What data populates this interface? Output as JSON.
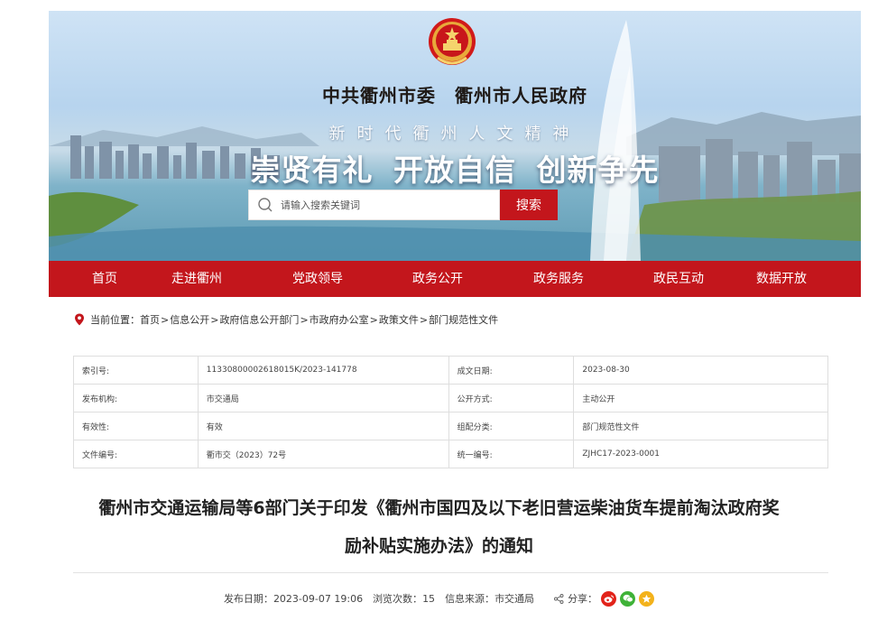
{
  "header": {
    "gov_title": "中共衢州市委　衢州市人民政府",
    "slogan_top": "新时代衢州人文精神",
    "slogan_main": "崇贤有礼 开放自信 创新争先",
    "search": {
      "placeholder": "请输入搜索关键词",
      "button_label": "搜索"
    },
    "colors": {
      "brand_red": "#c3161c"
    }
  },
  "nav": {
    "items": [
      {
        "label": "首页"
      },
      {
        "label": "走进衢州"
      },
      {
        "label": "党政领导"
      },
      {
        "label": "政务公开"
      },
      {
        "label": "政务服务"
      },
      {
        "label": "政民互动"
      },
      {
        "label": "数据开放"
      }
    ]
  },
  "breadcrumb": {
    "prefix": "当前位置：",
    "items": [
      "首页",
      "信息公开",
      "政府信息公开部门",
      "市政府办公室",
      "政策文件",
      "部门规范性文件"
    ],
    "separator": ">"
  },
  "meta_table": {
    "rows": [
      {
        "k1": "索引号:",
        "v1": "11330800002618015K/2023-141778",
        "k2": "成文日期:",
        "v2": "2023-08-30"
      },
      {
        "k1": "发布机构:",
        "v1": "市交通局",
        "k2": "公开方式:",
        "v2": "主动公开"
      },
      {
        "k1": "有效性:",
        "v1": "有效",
        "k2": "组配分类:",
        "v2": "部门规范性文件"
      },
      {
        "k1": "文件编号:",
        "v1": "衢市交（2023）72号",
        "k2": "统一编号:",
        "v2": "ZJHC17-2023-0001"
      }
    ]
  },
  "article": {
    "title_line1": "衢州市交通运输局等6部门关于印发《衢州市国四及以下老旧营运柴油货车提前淘汰政府奖",
    "title_line2": "励补贴实施办法》的通知",
    "publish_label": "发布日期：",
    "publish_date": "2023-09-07 19:06",
    "views_label": "浏览次数：",
    "views": "15",
    "source_label": "信息来源：",
    "source": "市交通局",
    "share_label": "分享：",
    "share_icons": [
      "weibo-icon",
      "wechat-icon",
      "qzone-icon"
    ]
  }
}
